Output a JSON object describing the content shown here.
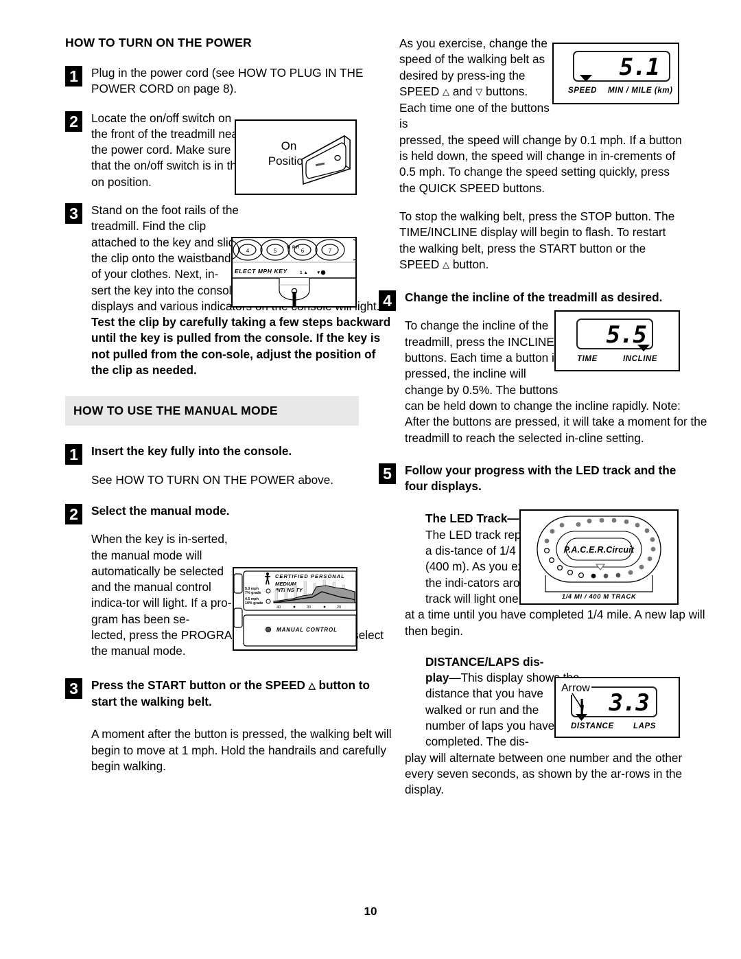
{
  "page": {
    "number": "10"
  },
  "left_column": {
    "section1": {
      "heading": "HOW TO TURN ON THE POWER",
      "steps": [
        {
          "num": "1",
          "text": "Plug in the power cord (see HOW TO PLUG IN THE POWER CORD on page 8)."
        },
        {
          "num": "2",
          "text": "Locate the on/off switch on the front of the treadmill near the power cord. Make sure that the on/off switch is in the on position."
        },
        {
          "num": "3",
          "text_narrow": "Stand on the foot rails of the treadmill. Find the clip attached to the key and slide the clip onto the waistband of your clothes. Next, in-",
          "text_rest_plain": "sert the key into the console. After a moment, the displays and various indicators on the console will light. ",
          "text_rest_bold": "Test the clip by carefully taking a few steps backward until the key is pulled from the console. If the key is not pulled from the con-sole, adjust the position of the clip as needed."
        }
      ],
      "figure_switch": {
        "label_line1": "On",
        "label_line2": "Position"
      },
      "figure_console": {
        "button_numbers": [
          "4",
          "5",
          "6",
          "7"
        ],
        "mph_label_left": "M",
        "mph_label_right": "P H",
        "select_text": "ELECT MPH KEY",
        "marks": [
          "1",
          "0"
        ]
      }
    },
    "section2": {
      "heading": "HOW TO USE THE MANUAL MODE",
      "steps": [
        {
          "num": "1",
          "title": "Insert the key fully into the console.",
          "body": "See HOW TO TURN ON THE POWER above."
        },
        {
          "num": "2",
          "title": "Select the manual mode.",
          "body_narrow": "When the key is in-serted, the manual mode will automatically be selected and the manual control indica-tor will light. If a pro-gram has been se-",
          "body_rest": "lected, press the PROGRAM button repeatedly to select the manual mode."
        },
        {
          "num": "3",
          "title_part1": "Press the START button or the SPEED ",
          "title_part2": " button to start the walking belt.",
          "body": "A moment after the button is pressed, the walking belt will begin to move at 1 mph. Hold the handrails and carefully begin walking."
        }
      ],
      "figure_program": {
        "title": "C E R T I F I E D   P E R S O N A L",
        "subtitle_line1": "MEDIUM",
        "subtitle_line2": "INTENSITY",
        "legend": [
          {
            "speed": "5.0 mph",
            "grade": "7% grade"
          },
          {
            "speed": "4.5 mph",
            "grade": "10% grade"
          }
        ],
        "axis_ticks": [
          "40",
          "30",
          "20"
        ],
        "manual_label": "MANUAL CONTROL"
      }
    }
  },
  "right_column": {
    "intro": {
      "para1_narrow": "As you exercise, change the speed of the walking belt as desired by press-ing the SPEED ",
      "para1_mid": " and ",
      "para1_tail": " buttons. Each time one of the buttons is",
      "para1_rest": "pressed, the speed will change by 0.1 mph. If a button is held down, the speed will change in in-crements of 0.5 mph. To change the speed setting quickly, press the QUICK SPEED buttons.",
      "para2_part1": "To stop the walking belt, press the STOP button. The TIME/INCLINE display will begin to flash. To restart the walking belt, press the START button or the SPEED ",
      "para2_part2": " button."
    },
    "display_speed": {
      "value": "5.1",
      "label_left": "SPEED",
      "label_right": "MIN / MILE (km)"
    },
    "step4": {
      "num": "4",
      "title": "Change the incline of the treadmill as desired.",
      "body_narrow": "To change the incline of the treadmill, press the INCLINE buttons. Each time a button is pressed, the incline will change by 0.5%. The buttons",
      "body_rest": "can be held down to change the incline rapidly. Note: After the buttons are pressed, it will take a moment for the treadmill to reach the selected in-cline setting."
    },
    "display_incline": {
      "value": "5.5",
      "label_left": "TIME",
      "label_right": "INCLINE"
    },
    "step5": {
      "num": "5",
      "title": "Follow your progress with the LED track and the four displays.",
      "led_title": "The LED Track—",
      "led_body_narrow": "The LED track represents a dis-tance of 1/4 mile (400 m). As you exercise, the indi-cators around the track will light one",
      "led_body_rest": "at a time until you have completed 1/4 mile. A new lap will then begin.",
      "distance_title_line1": "DISTANCE/LAPS dis-",
      "distance_title_line2": "play",
      "distance_body_narrow": "—This display shows the distance that you have walked or run and the number of laps you have completed. The dis-",
      "distance_body_rest": "play will alternate between one number and the other every seven seconds, as shown by the ar-rows in the display."
    },
    "figure_led_track": {
      "brand": "P.A.C.E.R.Circuit",
      "caption": "1/4 MI / 400 M TRACK"
    },
    "display_distance": {
      "value": "3.3",
      "annotation": "Arrow",
      "label_left": "DISTANCE",
      "label_right": "LAPS"
    }
  },
  "colors": {
    "band_bg": "#e8e8e8",
    "ink": "#000000",
    "paper": "#ffffff"
  }
}
